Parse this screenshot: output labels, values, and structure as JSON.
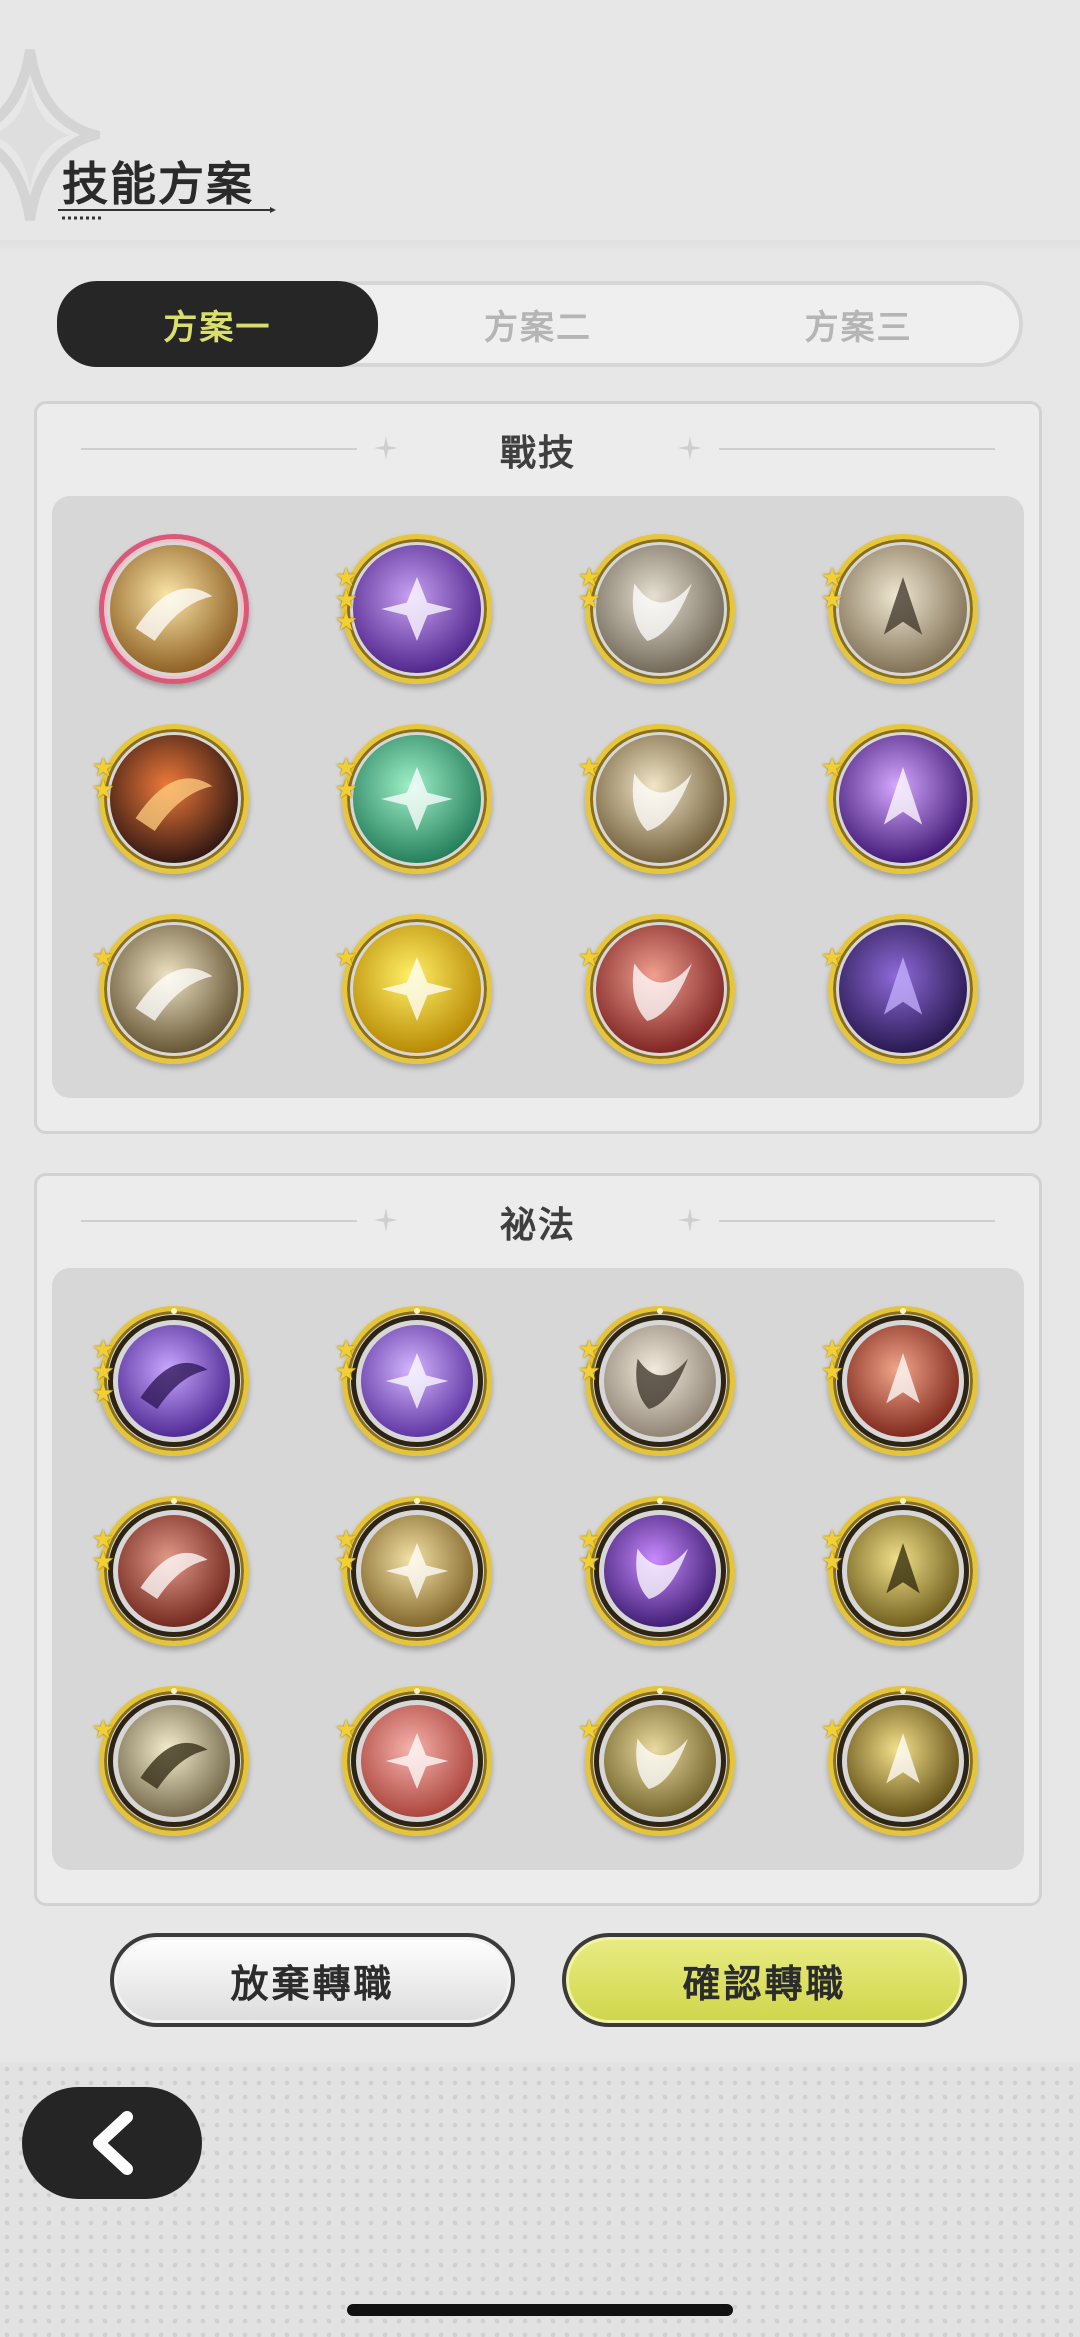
{
  "header": {
    "title": "技能方案"
  },
  "tabs": [
    {
      "label": "方案一",
      "active": true
    },
    {
      "label": "方案二",
      "active": false
    },
    {
      "label": "方案三",
      "active": false
    }
  ],
  "combat": {
    "title": "戰技",
    "skills": [
      {
        "icon": "golden-swirl-icon",
        "stars": 0,
        "selected": true
      },
      {
        "icon": "purple-heart-icon",
        "stars": 3
      },
      {
        "icon": "grey-vortex-icon",
        "stars": 2
      },
      {
        "icon": "grab-hand-icon",
        "stars": 2
      },
      {
        "icon": "flame-slash-icon",
        "stars": 2
      },
      {
        "icon": "green-rise-icon",
        "stars": 2
      },
      {
        "icon": "sword-burst-icon",
        "stars": 1
      },
      {
        "icon": "purple-orb-icon",
        "stars": 1
      },
      {
        "icon": "golden-slash-icon",
        "stars": 1
      },
      {
        "icon": "shield-up-icon",
        "stars": 1
      },
      {
        "icon": "red-warrior-icon",
        "stars": 1
      },
      {
        "icon": "shadow-claw-icon",
        "stars": 1
      }
    ]
  },
  "secret": {
    "title": "祕法",
    "skills": [
      {
        "icon": "purple-aura-figure-icon",
        "stars": 3
      },
      {
        "icon": "purple-summon-icon",
        "stars": 2
      },
      {
        "icon": "crystal-blade-icon",
        "stars": 2
      },
      {
        "icon": "red-claw-icon",
        "stars": 2
      },
      {
        "icon": "red-armor-icon",
        "stars": 2
      },
      {
        "icon": "golden-target-icon",
        "stars": 2
      },
      {
        "icon": "purple-flame-icon",
        "stars": 2
      },
      {
        "icon": "gold-heal-icon",
        "stars": 2
      },
      {
        "icon": "eye-icon",
        "stars": 1
      },
      {
        "icon": "red-sword-plus-icon",
        "stars": 1
      },
      {
        "icon": "gold-golem-icon",
        "stars": 1
      },
      {
        "icon": "gold-spirit-icon",
        "stars": 1
      }
    ]
  },
  "actions": {
    "cancel_label": "放棄轉職",
    "confirm_label": "確認轉職"
  },
  "colors": {
    "accent": "#d9df6a",
    "tab_active_bg": "#262626",
    "gold_border": "#e6c63c",
    "selected_border": "#d85a78"
  }
}
